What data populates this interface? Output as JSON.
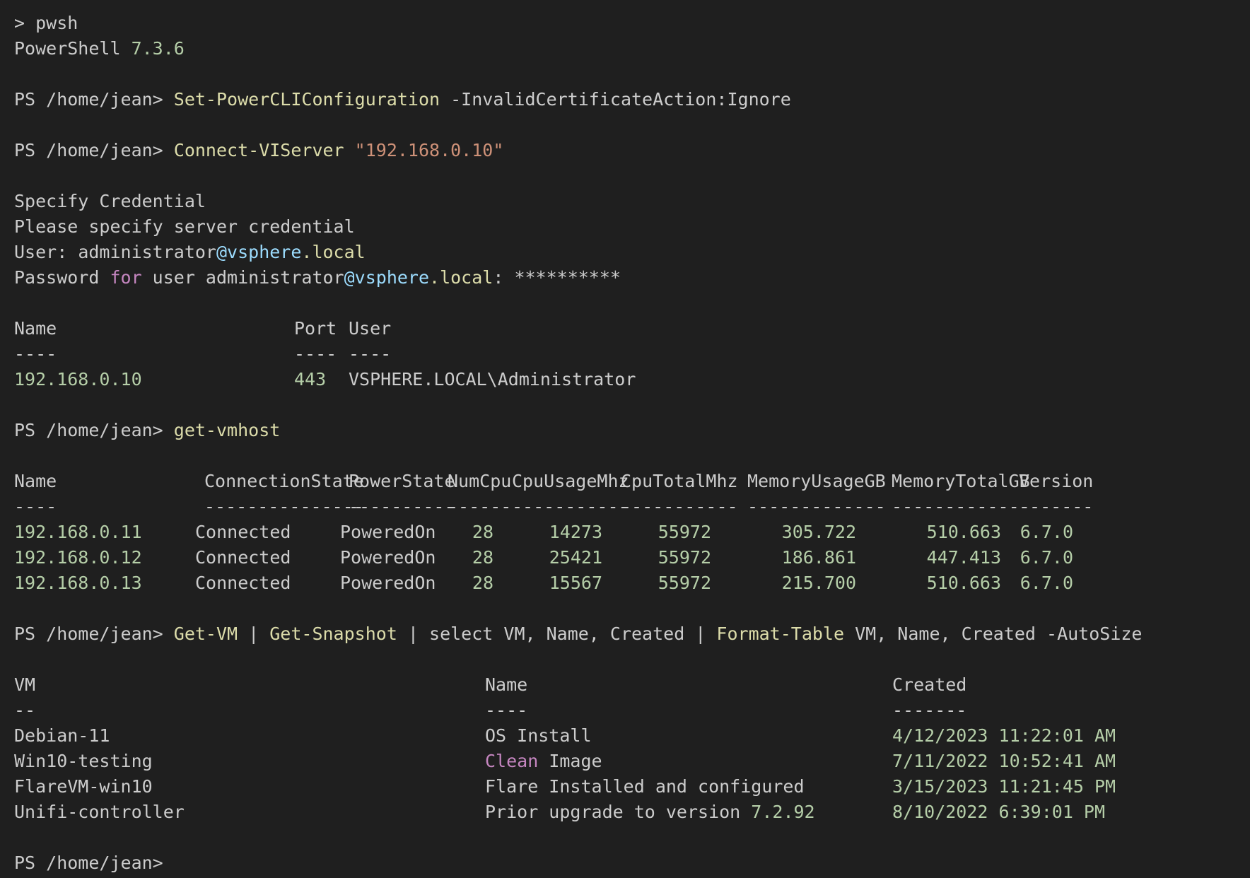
{
  "window": {
    "background": "#1f1f1f"
  },
  "colors": {
    "text": "#cccccc",
    "command": "#dcdcaa",
    "string": "#ce9178",
    "number": "#b5cea8",
    "variable": "#9cdcfe",
    "keyword": "#c586c0"
  },
  "session": {
    "launch": {
      "prompt": "> ",
      "command": "pwsh"
    },
    "banner": {
      "product": "PowerShell ",
      "version": "7.3.6"
    },
    "prompt": "PS /home/jean> "
  },
  "cmd1": {
    "cmdlet": "Set-PowerCLIConfiguration",
    "args": " -InvalidCertificateAction:Ignore"
  },
  "cmd2": {
    "cmdlet": "Connect-VIServer",
    "arg": "\"192.168.0.10\""
  },
  "credential": {
    "title": "Specify Credential",
    "message": "Please specify server credential",
    "user_label": "User: ",
    "user_name": "administrator",
    "user_domain_at": "@vsphere",
    "user_domain_tld": ".local",
    "password_label": "Password ",
    "password_for": "for",
    "password_mid": " user administrator",
    "password_domain_at": "@vsphere",
    "password_domain_tld": ".local",
    "password_colon": ": ",
    "password_mask": "**********"
  },
  "server_table": {
    "headers": {
      "name": "Name",
      "port": "Port",
      "user": "User"
    },
    "underline": {
      "name": "----",
      "port": "----",
      "user": "----"
    },
    "rows": [
      {
        "name": "192.168.0.10",
        "port": "443",
        "user": "VSPHERE.LOCAL\\Administrator"
      }
    ]
  },
  "cmd3": {
    "command": "get-vmhost"
  },
  "vmhost_table": {
    "headers": {
      "name": "Name",
      "connection_state": "ConnectionState",
      "power_state": "PowerState",
      "num_cpu": "NumCpu",
      "cpu_usage": "CpuUsageMhz",
      "cpu_total": "CpuTotalMhz",
      "mem_usage": "MemoryUsageGB",
      "mem_total": "MemoryTotalGB",
      "version": "Version"
    },
    "underline": {
      "name": "----",
      "connection_state": "---------------",
      "power_state": "----------",
      "num_cpu": "------",
      "cpu_usage": "-----------",
      "cpu_total": "-----------",
      "mem_usage": "-------------",
      "mem_total": "-------------",
      "version": "-------"
    },
    "rows": [
      {
        "name": "192.168.0.11",
        "connection_state": "Connected",
        "power_state": "PoweredOn",
        "num_cpu": "28",
        "cpu_usage": "14273",
        "cpu_total": "55972",
        "mem_usage": "305.722",
        "mem_total": "510.663",
        "version": "6.7.0"
      },
      {
        "name": "192.168.0.12",
        "connection_state": "Connected",
        "power_state": "PoweredOn",
        "num_cpu": "28",
        "cpu_usage": "25421",
        "cpu_total": "55972",
        "mem_usage": "186.861",
        "mem_total": "447.413",
        "version": "6.7.0"
      },
      {
        "name": "192.168.0.13",
        "connection_state": "Connected",
        "power_state": "PoweredOn",
        "num_cpu": "28",
        "cpu_usage": "15567",
        "cpu_total": "55972",
        "mem_usage": "215.700",
        "mem_total": "510.663",
        "version": "6.7.0"
      }
    ]
  },
  "cmd4": {
    "c1": "Get-VM",
    "pipe1": " | ",
    "c2": "Get-Snapshot",
    "mid": " | select VM, Name, Created | ",
    "c3": "Format-Table",
    "tail": " VM, Name, Created -AutoSize"
  },
  "snapshot_table": {
    "headers": {
      "vm": "VM",
      "name": "Name",
      "created": "Created"
    },
    "underline": {
      "vm": "--",
      "name": "----",
      "created": "-------"
    },
    "rows": [
      {
        "vm": "Debian-11",
        "name_kw": "",
        "name": "OS Install",
        "name_num": "",
        "created": "4/12/2023 11:22:01 AM"
      },
      {
        "vm": "Win10-testing",
        "name_kw": "Clean",
        "name": " Image",
        "name_num": "",
        "created": "7/11/2022 10:52:41 AM"
      },
      {
        "vm": "FlareVM-win10",
        "name_kw": "",
        "name": "Flare Installed and configured",
        "name_num": "",
        "created": "3/15/2023 11:21:45 PM"
      },
      {
        "vm": "Unifi-controller",
        "name_kw": "",
        "name": "Prior upgrade to version ",
        "name_num": "7.2.92",
        "created": "8/10/2022 6:39:01 PM"
      }
    ]
  }
}
